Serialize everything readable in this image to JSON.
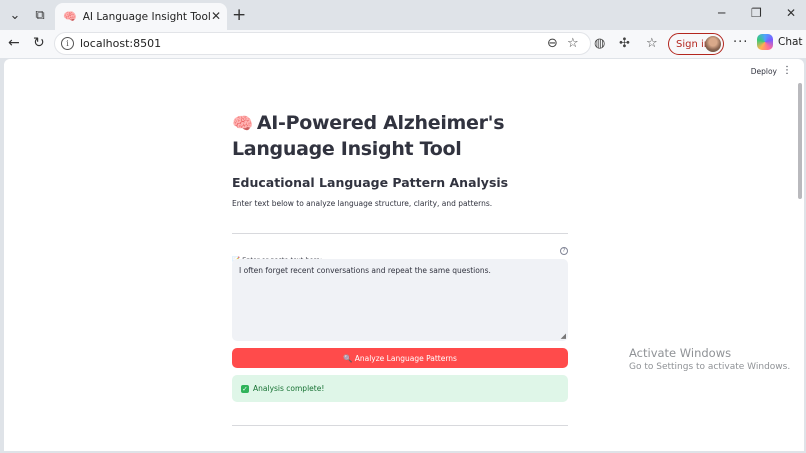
{
  "browser": {
    "tab_title": "AI Language Insight Tool",
    "tab_favicon": "🧠",
    "url": "localhost:8501",
    "signin_label": "Sign in",
    "chat_label": "Chat"
  },
  "app": {
    "deploy_label": "Deploy",
    "title_emoji": "🧠",
    "title": "AI-Powered Alzheimer's Language Insight Tool",
    "subtitle": "Educational Language Pattern Analysis",
    "intro": "Enter text below to analyze language structure, clarity, and patterns.",
    "input_label": "📝 Enter or paste text here:",
    "input_value": "I often forget recent conversations and repeat the same questions.",
    "analyze_button": "🔍 Analyze Language Patterns",
    "success_message": "Analysis complete!"
  },
  "os_watermark": {
    "line1": "Activate Windows",
    "line2": "Go to Settings to activate Windows."
  },
  "colors": {
    "primary_button": "#ff4b4b",
    "success_bg": "#dff6e8",
    "success_text": "#177233",
    "signin_border": "#b3261e"
  }
}
